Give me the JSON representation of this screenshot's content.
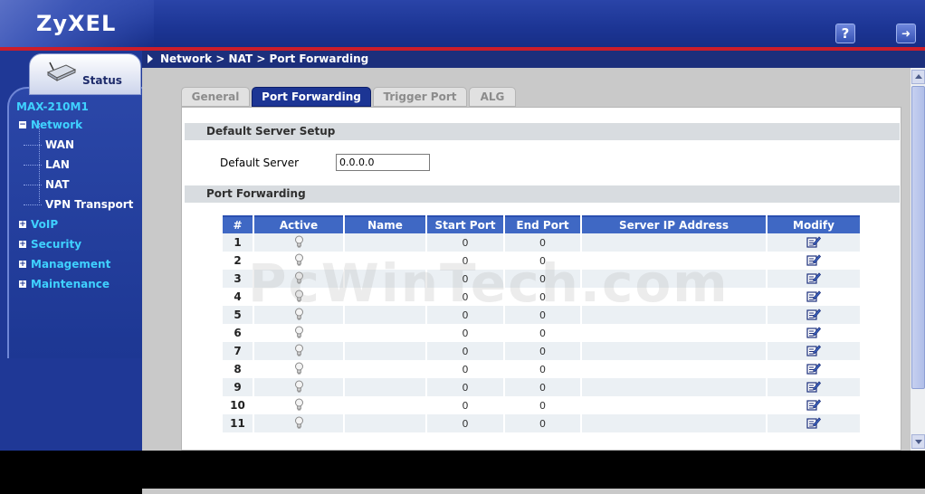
{
  "header": {
    "brand": "ZyXEL",
    "help_icon": "help-icon",
    "logout_icon": "logout-icon"
  },
  "breadcrumb": "Network > NAT > Port Forwarding",
  "sidebar": {
    "status_label": "Status",
    "model": "MAX-210M1",
    "items": [
      {
        "label": "Network",
        "level": 0,
        "expanded": true
      },
      {
        "label": "WAN",
        "level": 1
      },
      {
        "label": "LAN",
        "level": 1
      },
      {
        "label": "NAT",
        "level": 1
      },
      {
        "label": "VPN Transport",
        "level": 1
      },
      {
        "label": "VoIP",
        "level": 0,
        "expanded": false
      },
      {
        "label": "Security",
        "level": 0,
        "expanded": false
      },
      {
        "label": "Management",
        "level": 0,
        "expanded": false
      },
      {
        "label": "Maintenance",
        "level": 0,
        "expanded": false
      }
    ]
  },
  "tabs": [
    {
      "label": "General",
      "active": false
    },
    {
      "label": "Port Forwarding",
      "active": true
    },
    {
      "label": "Trigger Port",
      "active": false
    },
    {
      "label": "ALG",
      "active": false
    }
  ],
  "default_server_setup": {
    "heading": "Default Server Setup",
    "label": "Default Server",
    "value": "0.0.0.0"
  },
  "port_forwarding": {
    "heading": "Port Forwarding",
    "columns": [
      "#",
      "Active",
      "Name",
      "Start Port",
      "End Port",
      "Server IP Address",
      "Modify"
    ],
    "rows": [
      {
        "num": "1",
        "name": "",
        "start": "0",
        "end": "0",
        "ip": ""
      },
      {
        "num": "2",
        "name": "",
        "start": "0",
        "end": "0",
        "ip": ""
      },
      {
        "num": "3",
        "name": "",
        "start": "0",
        "end": "0",
        "ip": ""
      },
      {
        "num": "4",
        "name": "",
        "start": "0",
        "end": "0",
        "ip": ""
      },
      {
        "num": "5",
        "name": "",
        "start": "0",
        "end": "0",
        "ip": ""
      },
      {
        "num": "6",
        "name": "",
        "start": "0",
        "end": "0",
        "ip": ""
      },
      {
        "num": "7",
        "name": "",
        "start": "0",
        "end": "0",
        "ip": ""
      },
      {
        "num": "8",
        "name": "",
        "start": "0",
        "end": "0",
        "ip": ""
      },
      {
        "num": "9",
        "name": "",
        "start": "0",
        "end": "0",
        "ip": ""
      },
      {
        "num": "10",
        "name": "",
        "start": "0",
        "end": "0",
        "ip": ""
      },
      {
        "num": "11",
        "name": "",
        "start": "0",
        "end": "0",
        "ip": ""
      }
    ]
  },
  "watermark": "PcWinTech.com",
  "colors": {
    "header_blue": "#1c3594",
    "accent_red": "#cc1d2a",
    "nav_cyan": "#3fd1ff",
    "table_header": "#3f68c4"
  }
}
